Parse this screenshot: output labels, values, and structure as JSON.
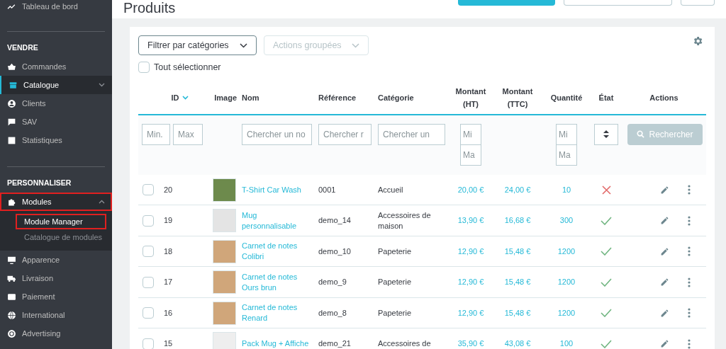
{
  "sidebar": {
    "sections": [
      {
        "items": [
          {
            "label": "Tableau de bord",
            "selected": false
          }
        ]
      },
      {
        "heading": "VENDRE",
        "items": [
          {
            "label": "Commandes",
            "selected": false
          },
          {
            "label": "Catalogue",
            "selected": true,
            "expanded": false
          },
          {
            "label": "Clients",
            "selected": false
          },
          {
            "label": "SAV",
            "selected": false
          },
          {
            "label": "Statistiques",
            "selected": false
          }
        ]
      },
      {
        "heading": "PERSONNALISER",
        "items": [
          {
            "label": "Modules",
            "selected": false,
            "expanded": true,
            "annotated": true,
            "children": [
              {
                "label": "Module Manager",
                "selected": true,
                "annotated": true
              },
              {
                "label": "Catalogue de modules",
                "selected": false,
                "annotated": false
              }
            ]
          },
          {
            "label": "Apparence",
            "selected": false
          },
          {
            "label": "Livraison",
            "selected": false
          },
          {
            "label": "Paiement",
            "selected": false
          },
          {
            "label": "International",
            "selected": false
          },
          {
            "label": "Advertising",
            "selected": false
          }
        ]
      }
    ]
  },
  "page": {
    "title": "Produits"
  },
  "toolbar": {
    "category_filter": "Filtrer par catégories",
    "bulk_actions": "Actions groupées",
    "select_all": {
      "label": "Tout sélectionner",
      "checked": false
    }
  },
  "table": {
    "columns": [
      {
        "label": "ID",
        "sorted": true
      },
      {
        "label": "Image",
        "sorted": false
      },
      {
        "label": "Nom",
        "sorted": false
      },
      {
        "label": "Référence",
        "sorted": false
      },
      {
        "label": "Catégorie",
        "sorted": false
      },
      {
        "label": "Montant (HT)",
        "sorted": false
      },
      {
        "label": "Montant (TTC)",
        "sorted": false
      },
      {
        "label": "Quantité",
        "sorted": false
      },
      {
        "label": "État",
        "sorted": false
      },
      {
        "label": "Actions",
        "sorted": false
      }
    ],
    "filters": {
      "id_min": {
        "placeholder": "Min."
      },
      "id_max": {
        "placeholder": "Max"
      },
      "name": {
        "placeholder": "Chercher un no"
      },
      "reference": {
        "placeholder": "Chercher r"
      },
      "category": {
        "placeholder": "Chercher un"
      },
      "ht_min": {
        "placeholder": "Mi"
      },
      "ht_max": {
        "placeholder": "Ma"
      },
      "qty_min": {
        "placeholder": "Mi"
      },
      "qty_max": {
        "placeholder": "Ma"
      },
      "search_button": "Rechercher"
    },
    "rows": [
      {
        "checked": false,
        "id": "20",
        "name": "T-Shirt Car Wash",
        "reference": "0001",
        "category": "Accueil",
        "price_ht": "20,00 €",
        "price_ttc": "24,00 €",
        "quantity": "10",
        "active": false
      },
      {
        "checked": false,
        "id": "19",
        "name": "Mug personnalisable",
        "reference": "demo_14",
        "category": "Accessoires de maison",
        "price_ht": "13,90 €",
        "price_ttc": "16,68 €",
        "quantity": "300",
        "active": true
      },
      {
        "checked": false,
        "id": "18",
        "name": "Carnet de notes Colibri",
        "reference": "demo_10",
        "category": "Papeterie",
        "price_ht": "12,90 €",
        "price_ttc": "15,48 €",
        "quantity": "1200",
        "active": true
      },
      {
        "checked": false,
        "id": "17",
        "name": "Carnet de notes Ours brun",
        "reference": "demo_9",
        "category": "Papeterie",
        "price_ht": "12,90 €",
        "price_ttc": "15,48 €",
        "quantity": "1200",
        "active": true
      },
      {
        "checked": false,
        "id": "16",
        "name": "Carnet de notes Renard",
        "reference": "demo_8",
        "category": "Papeterie",
        "price_ht": "12,90 €",
        "price_ttc": "15,48 €",
        "quantity": "1200",
        "active": true
      },
      {
        "checked": false,
        "id": "15",
        "name": "Pack Mug + Affiche",
        "reference": "demo_21",
        "category": "Accessoires de",
        "price_ht": "35,90 €",
        "price_ttc": "43,08 €",
        "quantity": "100",
        "active": true
      }
    ]
  }
}
